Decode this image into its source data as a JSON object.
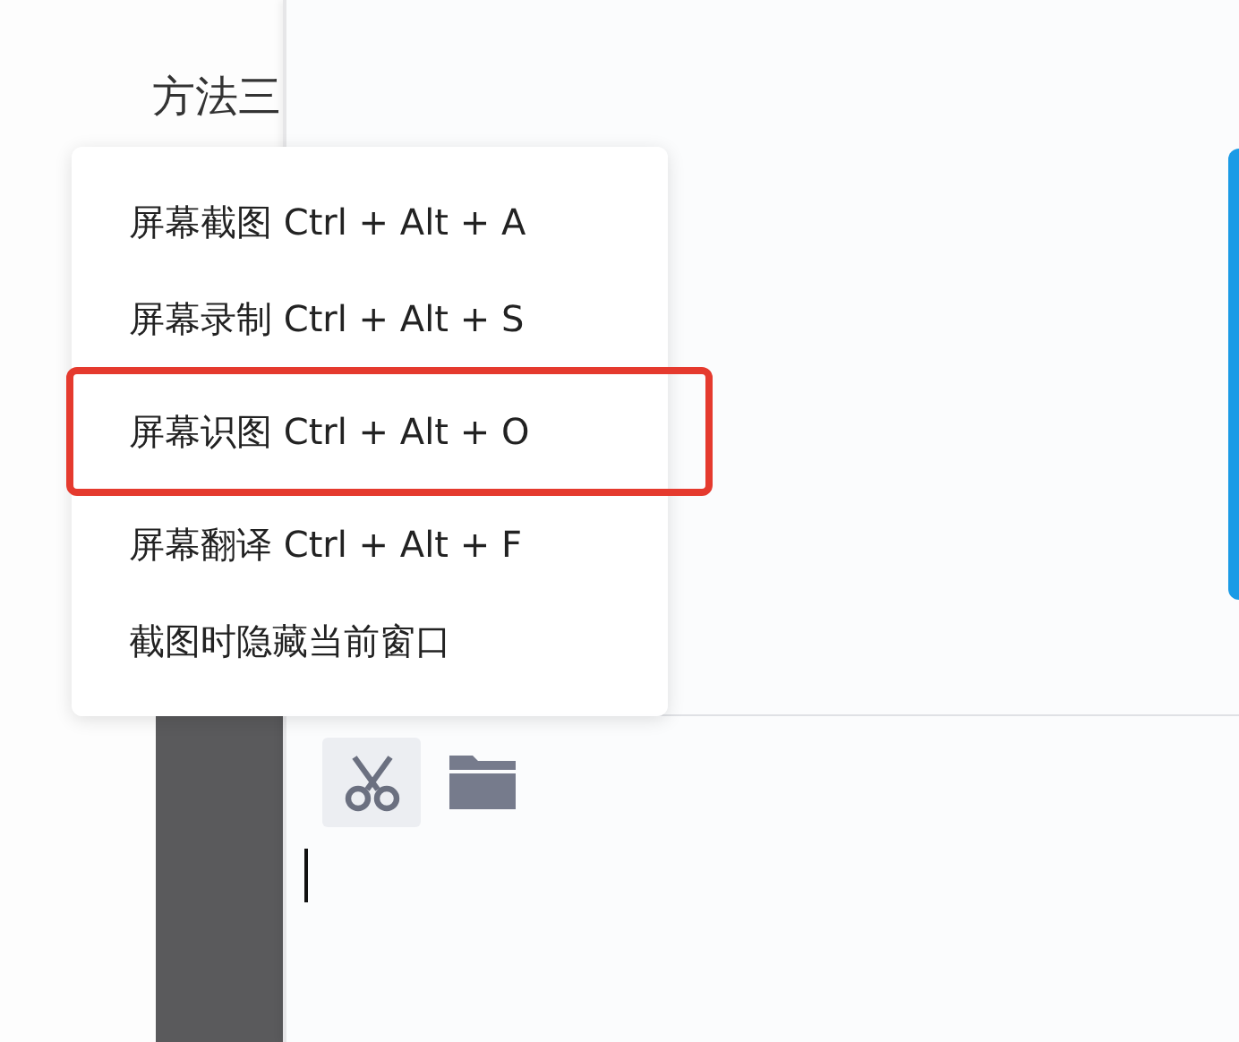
{
  "heading": "方法三",
  "menu": {
    "items": [
      {
        "label": "屏幕截图 Ctrl + Alt + A",
        "highlighted": false
      },
      {
        "label": "屏幕录制 Ctrl + Alt + S",
        "highlighted": false
      },
      {
        "label": "屏幕识图 Ctrl + Alt + O",
        "highlighted": true
      },
      {
        "label": "屏幕翻译 Ctrl + Alt + F",
        "highlighted": false
      },
      {
        "label": "截图时隐藏当前窗口",
        "highlighted": false
      }
    ]
  },
  "toolbar": [
    {
      "kind": "scissors",
      "selected": true
    },
    {
      "kind": "folder",
      "selected": false
    }
  ]
}
